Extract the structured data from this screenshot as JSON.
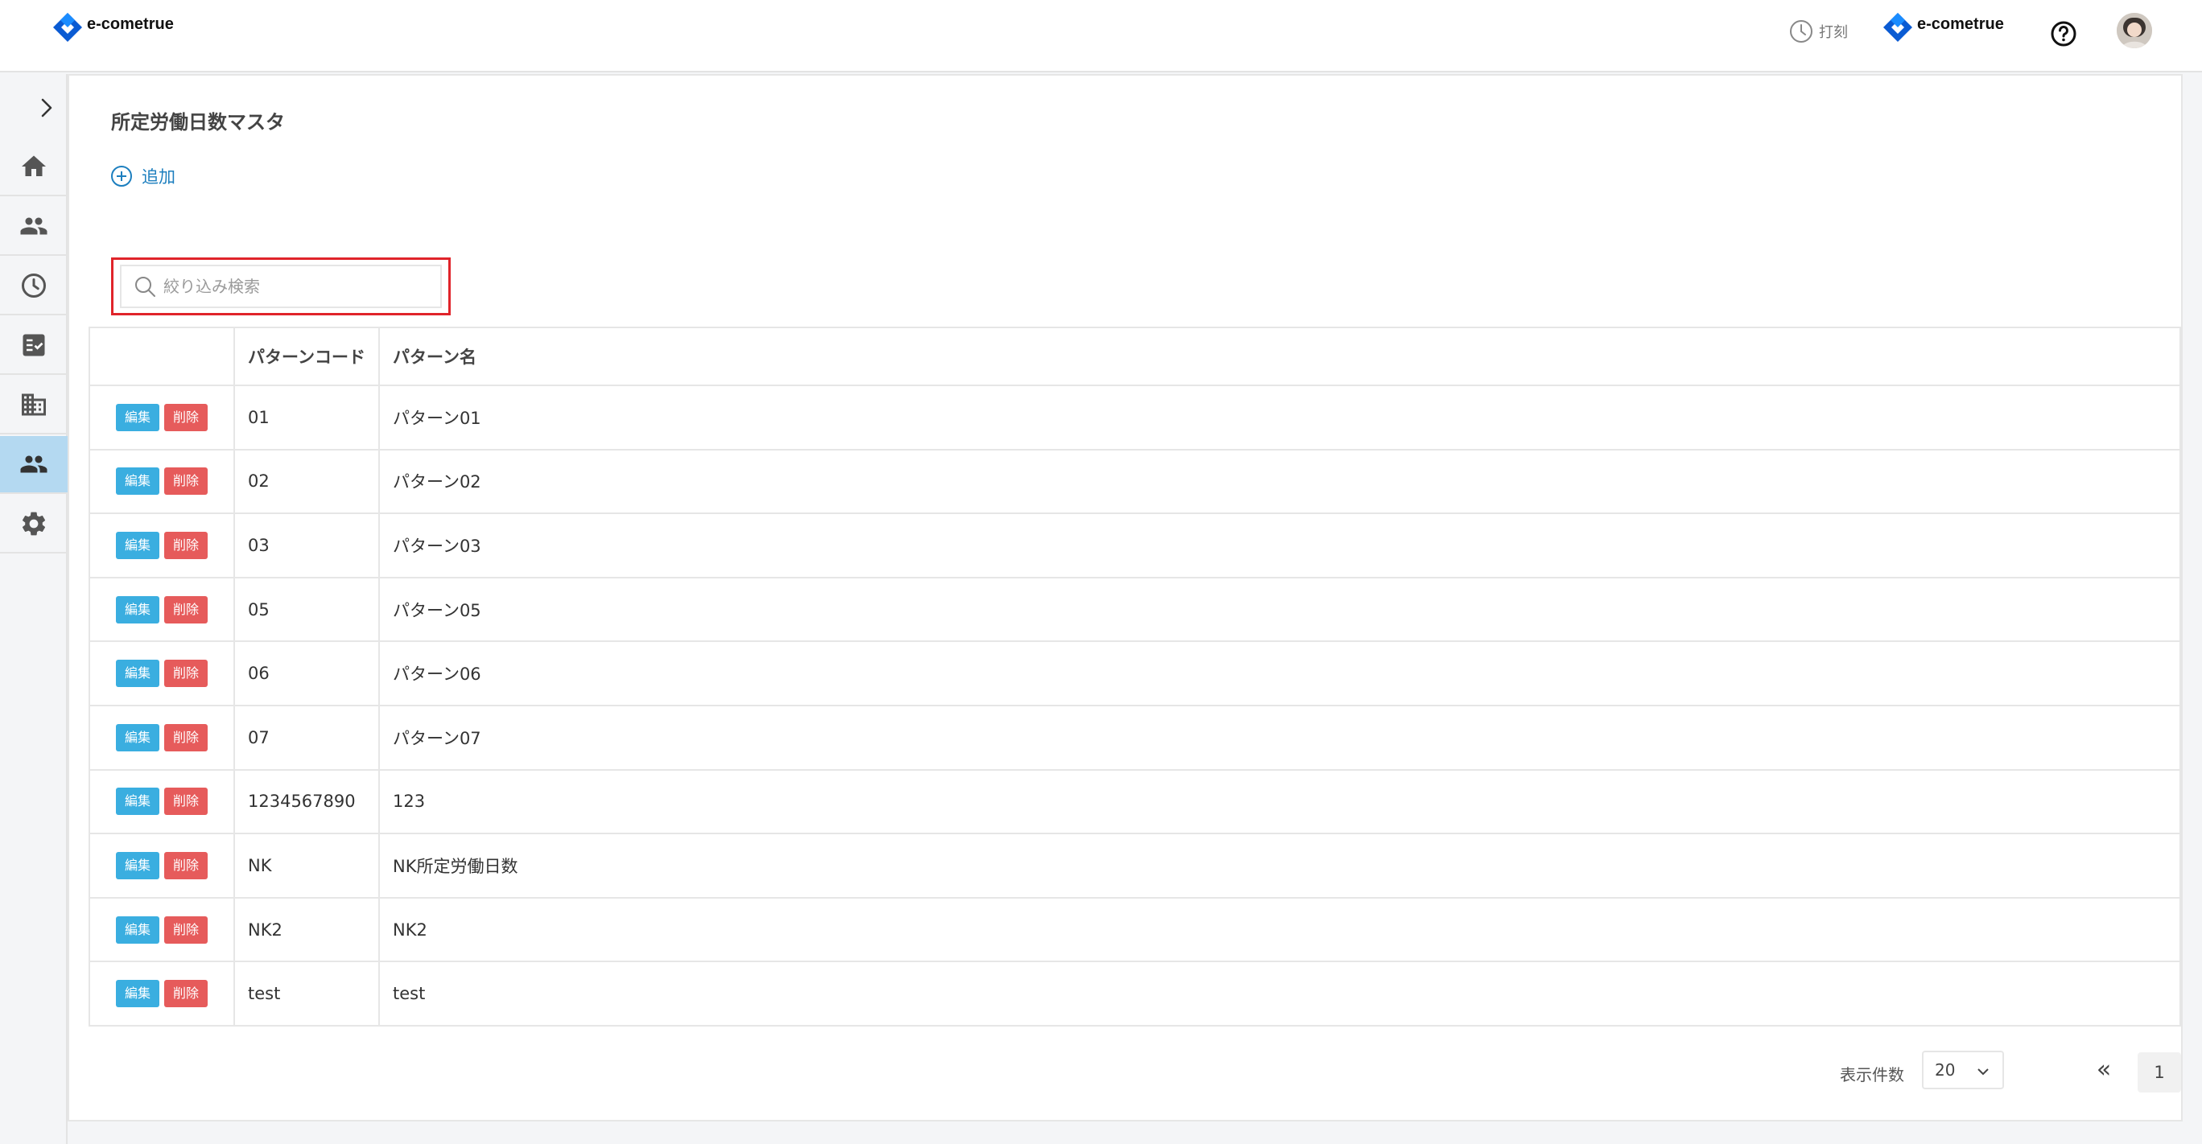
{
  "header": {
    "brand": "e-cometrue",
    "brand_right": "e-cometrue",
    "punch_label": "打刻",
    "brand_color": "#0a5bd3"
  },
  "sidebar": {
    "items": [
      {
        "icon": "home-icon",
        "active": false
      },
      {
        "icon": "people-icon",
        "active": false
      },
      {
        "icon": "clock-icon",
        "active": false
      },
      {
        "icon": "checklist-icon",
        "active": false
      },
      {
        "icon": "building-icon",
        "active": false
      },
      {
        "icon": "people-icon",
        "active": true
      },
      {
        "icon": "gear-icon",
        "active": false
      }
    ],
    "active_color": "#b4d9f1"
  },
  "main": {
    "title": "所定労働日数マスタ",
    "add_label": "追加",
    "search_placeholder": "絞り込み検索"
  },
  "table": {
    "headers": [
      "",
      "パターンコード",
      "パターン名"
    ],
    "edit_label": "編集",
    "delete_label": "削除",
    "rows": [
      {
        "code": "01",
        "name": "パターン01"
      },
      {
        "code": "02",
        "name": "パターン02"
      },
      {
        "code": "03",
        "name": "パターン03"
      },
      {
        "code": "05",
        "name": "パターン05"
      },
      {
        "code": "06",
        "name": "パターン06"
      },
      {
        "code": "07",
        "name": "パターン07"
      },
      {
        "code": "1234567890",
        "name": "123"
      },
      {
        "code": "NK",
        "name": "NK所定労働日数"
      },
      {
        "code": "NK2",
        "name": "NK2"
      },
      {
        "code": "test",
        "name": "test"
      }
    ]
  },
  "pagination": {
    "per_page_label": "表示件数",
    "per_page_value": "20",
    "first_label": "«",
    "current_page": "1",
    "last_label": "»"
  }
}
